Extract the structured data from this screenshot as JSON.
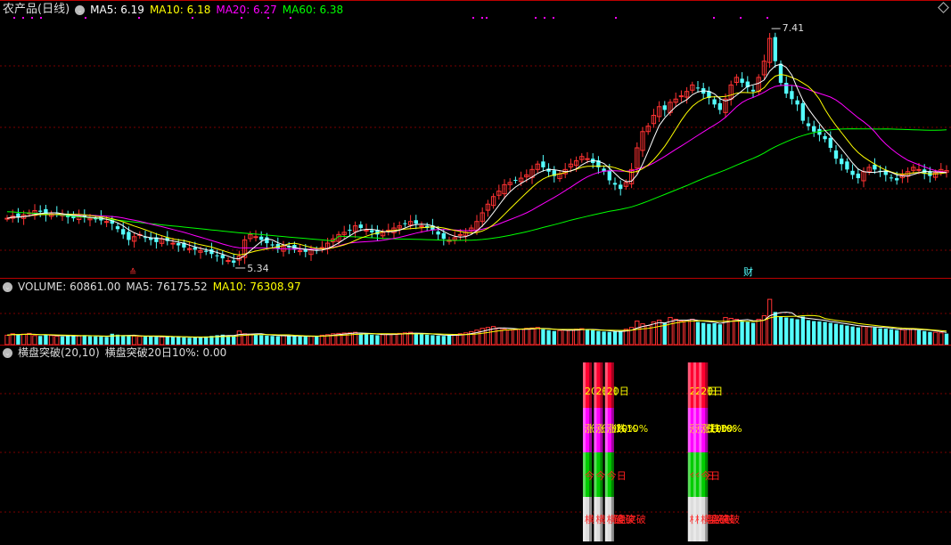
{
  "colors": {
    "up": "#ff3232",
    "down": "#54ffff",
    "ma5": "#ffffff",
    "ma10": "#ffff00",
    "ma20": "#ff00ff",
    "ma60": "#00ff00",
    "grid": "#7a0000",
    "sep": "#bb0000"
  },
  "header_main": {
    "name": "农产品(日线)",
    "ma5": "MA5: 6.19",
    "ma10": "MA10: 6.18",
    "ma20": "MA20: 6.27",
    "ma60": "MA60: 6.38"
  },
  "header_volume": {
    "label": "VOLUME: 60861.00",
    "ma5": "MA5: 76175.52",
    "ma10": "MA10: 76308.97"
  },
  "header_indicator": {
    "name": "横盘突破(20,10)",
    "value": "横盘突破20日10%: 0.00"
  },
  "icons": {
    "toggle": "chevron-down-icon",
    "expand": "diamond-icon"
  },
  "chart_data": [
    {
      "type": "candlestick",
      "name": "农产品(日线)",
      "series": [
        {
          "name": "MA5",
          "value": 6.19
        },
        {
          "name": "MA10",
          "value": 6.18
        },
        {
          "name": "MA20",
          "value": 6.27
        },
        {
          "name": "MA60",
          "value": 6.38
        }
      ],
      "annotations": [
        {
          "text": "7.41",
          "kind": "high"
        },
        {
          "text": "5.34",
          "kind": "low"
        },
        {
          "text": "财",
          "kind": "marker"
        },
        {
          "text": "≙",
          "kind": "marker"
        }
      ],
      "ylim": [
        5.2,
        7.6
      ],
      "closes": [
        5.75,
        5.77,
        5.76,
        5.78,
        5.8,
        5.82,
        5.81,
        5.78,
        5.79,
        5.8,
        5.78,
        5.76,
        5.75,
        5.77,
        5.76,
        5.75,
        5.74,
        5.73,
        5.72,
        5.7,
        5.65,
        5.6,
        5.55,
        5.58,
        5.6,
        5.57,
        5.55,
        5.53,
        5.56,
        5.54,
        5.52,
        5.5,
        5.48,
        5.47,
        5.46,
        5.45,
        5.44,
        5.42,
        5.4,
        5.38,
        5.36,
        5.34,
        5.4,
        5.55,
        5.6,
        5.58,
        5.55,
        5.52,
        5.5,
        5.47,
        5.49,
        5.48,
        5.46,
        5.45,
        5.44,
        5.46,
        5.45,
        5.48,
        5.52,
        5.56,
        5.6,
        5.62,
        5.64,
        5.68,
        5.66,
        5.64,
        5.62,
        5.6,
        5.62,
        5.64,
        5.66,
        5.68,
        5.7,
        5.72,
        5.7,
        5.68,
        5.66,
        5.64,
        5.6,
        5.56,
        5.55,
        5.57,
        5.6,
        5.62,
        5.66,
        5.72,
        5.8,
        5.88,
        5.95,
        6.0,
        6.06,
        6.08,
        6.1,
        6.12,
        6.15,
        6.2,
        6.25,
        6.22,
        6.18,
        6.14,
        6.16,
        6.2,
        6.25,
        6.28,
        6.32,
        6.3,
        6.26,
        6.22,
        6.18,
        6.1,
        6.06,
        6.02,
        6.08,
        6.2,
        6.4,
        6.55,
        6.6,
        6.7,
        6.78,
        6.75,
        6.82,
        6.85,
        6.88,
        6.92,
        6.98,
        6.95,
        6.9,
        6.86,
        6.8,
        6.75,
        6.85,
        6.98,
        7.05,
        7.0,
        6.96,
        6.92,
        7.05,
        7.2,
        7.41,
        7.2,
        7.0,
        6.9,
        6.85,
        6.8,
        6.65,
        6.6,
        6.55,
        6.52,
        6.48,
        6.4,
        6.3,
        6.25,
        6.2,
        6.15,
        6.12,
        6.18,
        6.22,
        6.2,
        6.18,
        6.15,
        6.12,
        6.1,
        6.15,
        6.18,
        6.22,
        6.2,
        6.16,
        6.14,
        6.17,
        6.2,
        6.19
      ]
    },
    {
      "type": "bar",
      "name": "VOLUME",
      "series": [
        {
          "name": "VOLUME",
          "value": 60861.0
        },
        {
          "name": "MA5",
          "value": 76175.52
        },
        {
          "name": "MA10",
          "value": 76308.97
        }
      ],
      "ylim": [
        0,
        280000
      ],
      "values": [
        52000,
        60000,
        55000,
        58000,
        62000,
        50000,
        48000,
        55000,
        50000,
        47000,
        45000,
        52000,
        50000,
        48000,
        52000,
        46000,
        45000,
        44000,
        42000,
        60000,
        55000,
        50000,
        48000,
        47000,
        45000,
        44000,
        46000,
        43000,
        42000,
        45000,
        44000,
        42000,
        40000,
        38000,
        40000,
        42000,
        45000,
        48000,
        52000,
        55000,
        50000,
        48000,
        75000,
        60000,
        58000,
        55000,
        52000,
        50000,
        48000,
        46000,
        50000,
        48000,
        47000,
        45000,
        44000,
        46000,
        48000,
        52000,
        55000,
        60000,
        62000,
        64000,
        65000,
        68000,
        60000,
        58000,
        55000,
        52000,
        55000,
        58000,
        60000,
        62000,
        65000,
        68000,
        62000,
        58000,
        55000,
        52000,
        50000,
        48000,
        52000,
        55000,
        60000,
        65000,
        72000,
        80000,
        90000,
        95000,
        100000,
        92000,
        85000,
        80000,
        82000,
        85000,
        90000,
        92000,
        95000,
        85000,
        80000,
        75000,
        78000,
        80000,
        82000,
        85000,
        88000,
        85000,
        80000,
        75000,
        72000,
        70000,
        72000,
        75000,
        85000,
        95000,
        130000,
        115000,
        105000,
        125000,
        135000,
        120000,
        150000,
        140000,
        130000,
        135000,
        140000,
        125000,
        120000,
        115000,
        118000,
        112000,
        150000,
        145000,
        140000,
        130000,
        125000,
        120000,
        140000,
        160000,
        250000,
        180000,
        155000,
        150000,
        145000,
        140000,
        155000,
        135000,
        130000,
        128000,
        125000,
        120000,
        115000,
        110000,
        105000,
        100000,
        95000,
        100000,
        98000,
        95000,
        90000,
        88000,
        85000,
        80000,
        82000,
        85000,
        88000,
        80000,
        75000,
        70000,
        68000,
        65000,
        60861
      ]
    },
    {
      "type": "bar",
      "name": "横盘突破(20,10)",
      "series": [
        {
          "name": "横盘突破20日10%",
          "value": 0.0
        }
      ],
      "segment_labels": [
        "20日",
        "涨跌10%",
        "今日",
        "横盘突破"
      ],
      "signal_indices": [
        105,
        107,
        109,
        124,
        125,
        126
      ]
    }
  ]
}
